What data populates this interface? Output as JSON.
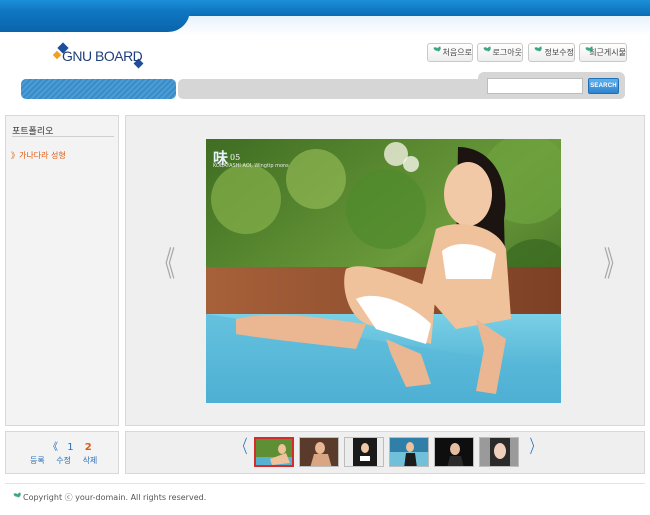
{
  "logo": {
    "text": "GNU BOARD"
  },
  "nav": {
    "items": [
      {
        "label": "처음으로"
      },
      {
        "label": "로그아웃"
      },
      {
        "label": "정보수정"
      },
      {
        "label": "최근게시물"
      }
    ]
  },
  "search": {
    "value": "",
    "button_label": "SEARCH"
  },
  "sidebar": {
    "title": "포트폴리오",
    "items": [
      {
        "label": "》가나다라 성형"
      }
    ]
  },
  "viewer": {
    "prev_glyph": "《",
    "next_glyph": "》",
    "caption_big": "味",
    "caption_num": "05",
    "caption_small": "KOBAYASHI AOI, Wingtip mons"
  },
  "pager": {
    "prev_glyph": "《",
    "pages": [
      "1",
      "2"
    ],
    "current_page": "2",
    "actions": [
      "등록",
      "수정",
      "삭제"
    ]
  },
  "thumbnails": {
    "prev_glyph": "〈",
    "next_glyph": "〉",
    "count": 6,
    "active_index": 0
  },
  "footer": {
    "text": "Copyright ⓒ your-domain. All rights reserved."
  }
}
